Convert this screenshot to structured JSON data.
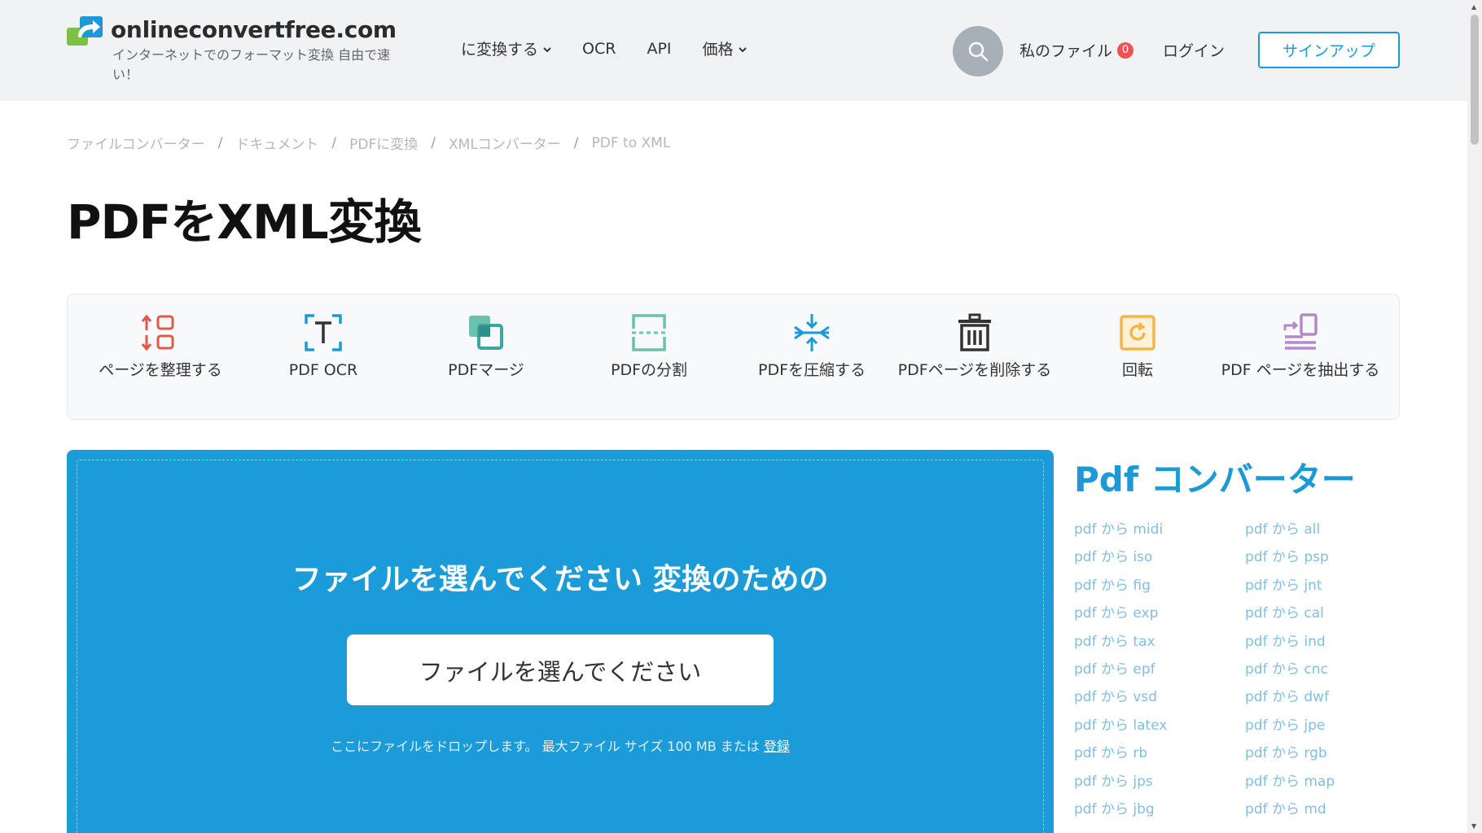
{
  "header": {
    "logo_name": "onlineconvertfree.com",
    "logo_tagline": "インターネットでのフォーマット変換 自由で速い！",
    "nav": [
      {
        "label": "に変換する",
        "dropdown": true
      },
      {
        "label": "OCR",
        "dropdown": false
      },
      {
        "label": "API",
        "dropdown": false
      },
      {
        "label": "価格",
        "dropdown": true
      }
    ],
    "my_files_label": "私のファイル",
    "my_files_count": "0",
    "login_label": "ログイン",
    "signup_label": "サインアップ"
  },
  "breadcrumb": [
    "ファイルコンバーター",
    "ドキュメント",
    "PDFに変換",
    "XMLコンバーター",
    "PDF to XML"
  ],
  "page_title": "PDFをXML変換",
  "tools": [
    {
      "label": "ページを整理する",
      "icon": "organize-pages-icon",
      "color": "#e05a4b"
    },
    {
      "label": "PDF OCR",
      "icon": "ocr-icon",
      "color": "#1d9ad6"
    },
    {
      "label": "PDFマージ",
      "icon": "merge-icon",
      "color": "#3aa7a3"
    },
    {
      "label": "PDFの分割",
      "icon": "split-icon",
      "color": "#6cc0ae"
    },
    {
      "label": "PDFを圧縮する",
      "icon": "compress-icon",
      "color": "#1d9ad6"
    },
    {
      "label": "PDFページを削除する",
      "icon": "trash-icon",
      "color": "#333333"
    },
    {
      "label": "回転",
      "icon": "rotate-icon",
      "color": "#f4b64a"
    },
    {
      "label": "PDF ページを抽出する",
      "icon": "extract-pages-icon",
      "color": "#b489c9"
    }
  ],
  "upload": {
    "title": "ファイルを選んでください 変換のための",
    "button_label": "ファイルを選んでください",
    "note": "ここにファイルをドロップします。 最大ファイル サイズ 100 MB または",
    "register_label": "登録",
    "bg_color": "#1b9bd8"
  },
  "sidebar": {
    "title": "Pdf コンバーター",
    "col1": [
      "pdf から midi",
      "pdf から iso",
      "pdf から fig",
      "pdf から exp",
      "pdf から tax",
      "pdf から epf",
      "pdf から vsd",
      "pdf から latex",
      "pdf から rb",
      "pdf から jps",
      "pdf から jbg"
    ],
    "col2": [
      "pdf から all",
      "pdf から psp",
      "pdf から jnt",
      "pdf から cal",
      "pdf から ind",
      "pdf から cnc",
      "pdf から dwf",
      "pdf から jpe",
      "pdf から rgb",
      "pdf から map",
      "pdf から md"
    ]
  },
  "colors": {
    "accent": "#1d9ad6",
    "header_bg": "#f1f2f4",
    "badge": "#ef5350"
  }
}
